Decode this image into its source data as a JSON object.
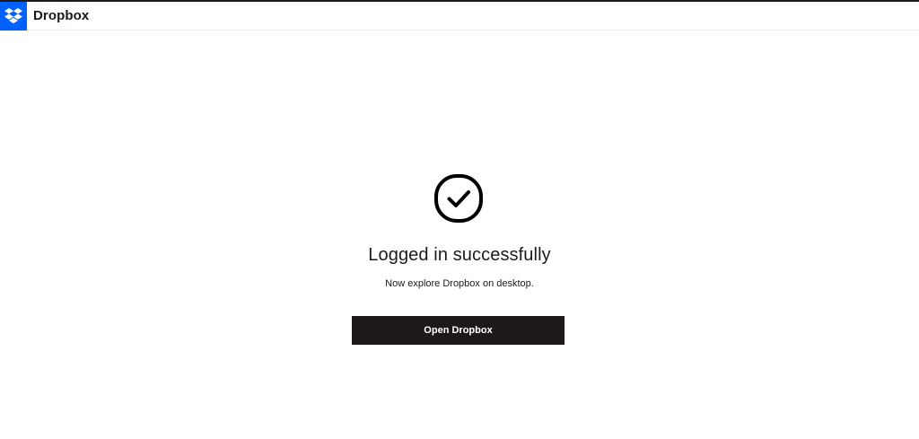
{
  "header": {
    "brand": "Dropbox",
    "logo_icon": "dropbox-logo-icon",
    "logo_color": "#0061fe"
  },
  "main": {
    "status_icon": "check-circle-icon",
    "title": "Logged in successfully",
    "subtitle": "Now explore Dropbox on desktop.",
    "open_button_label": "Open Dropbox",
    "button_color": "#1e1919"
  }
}
